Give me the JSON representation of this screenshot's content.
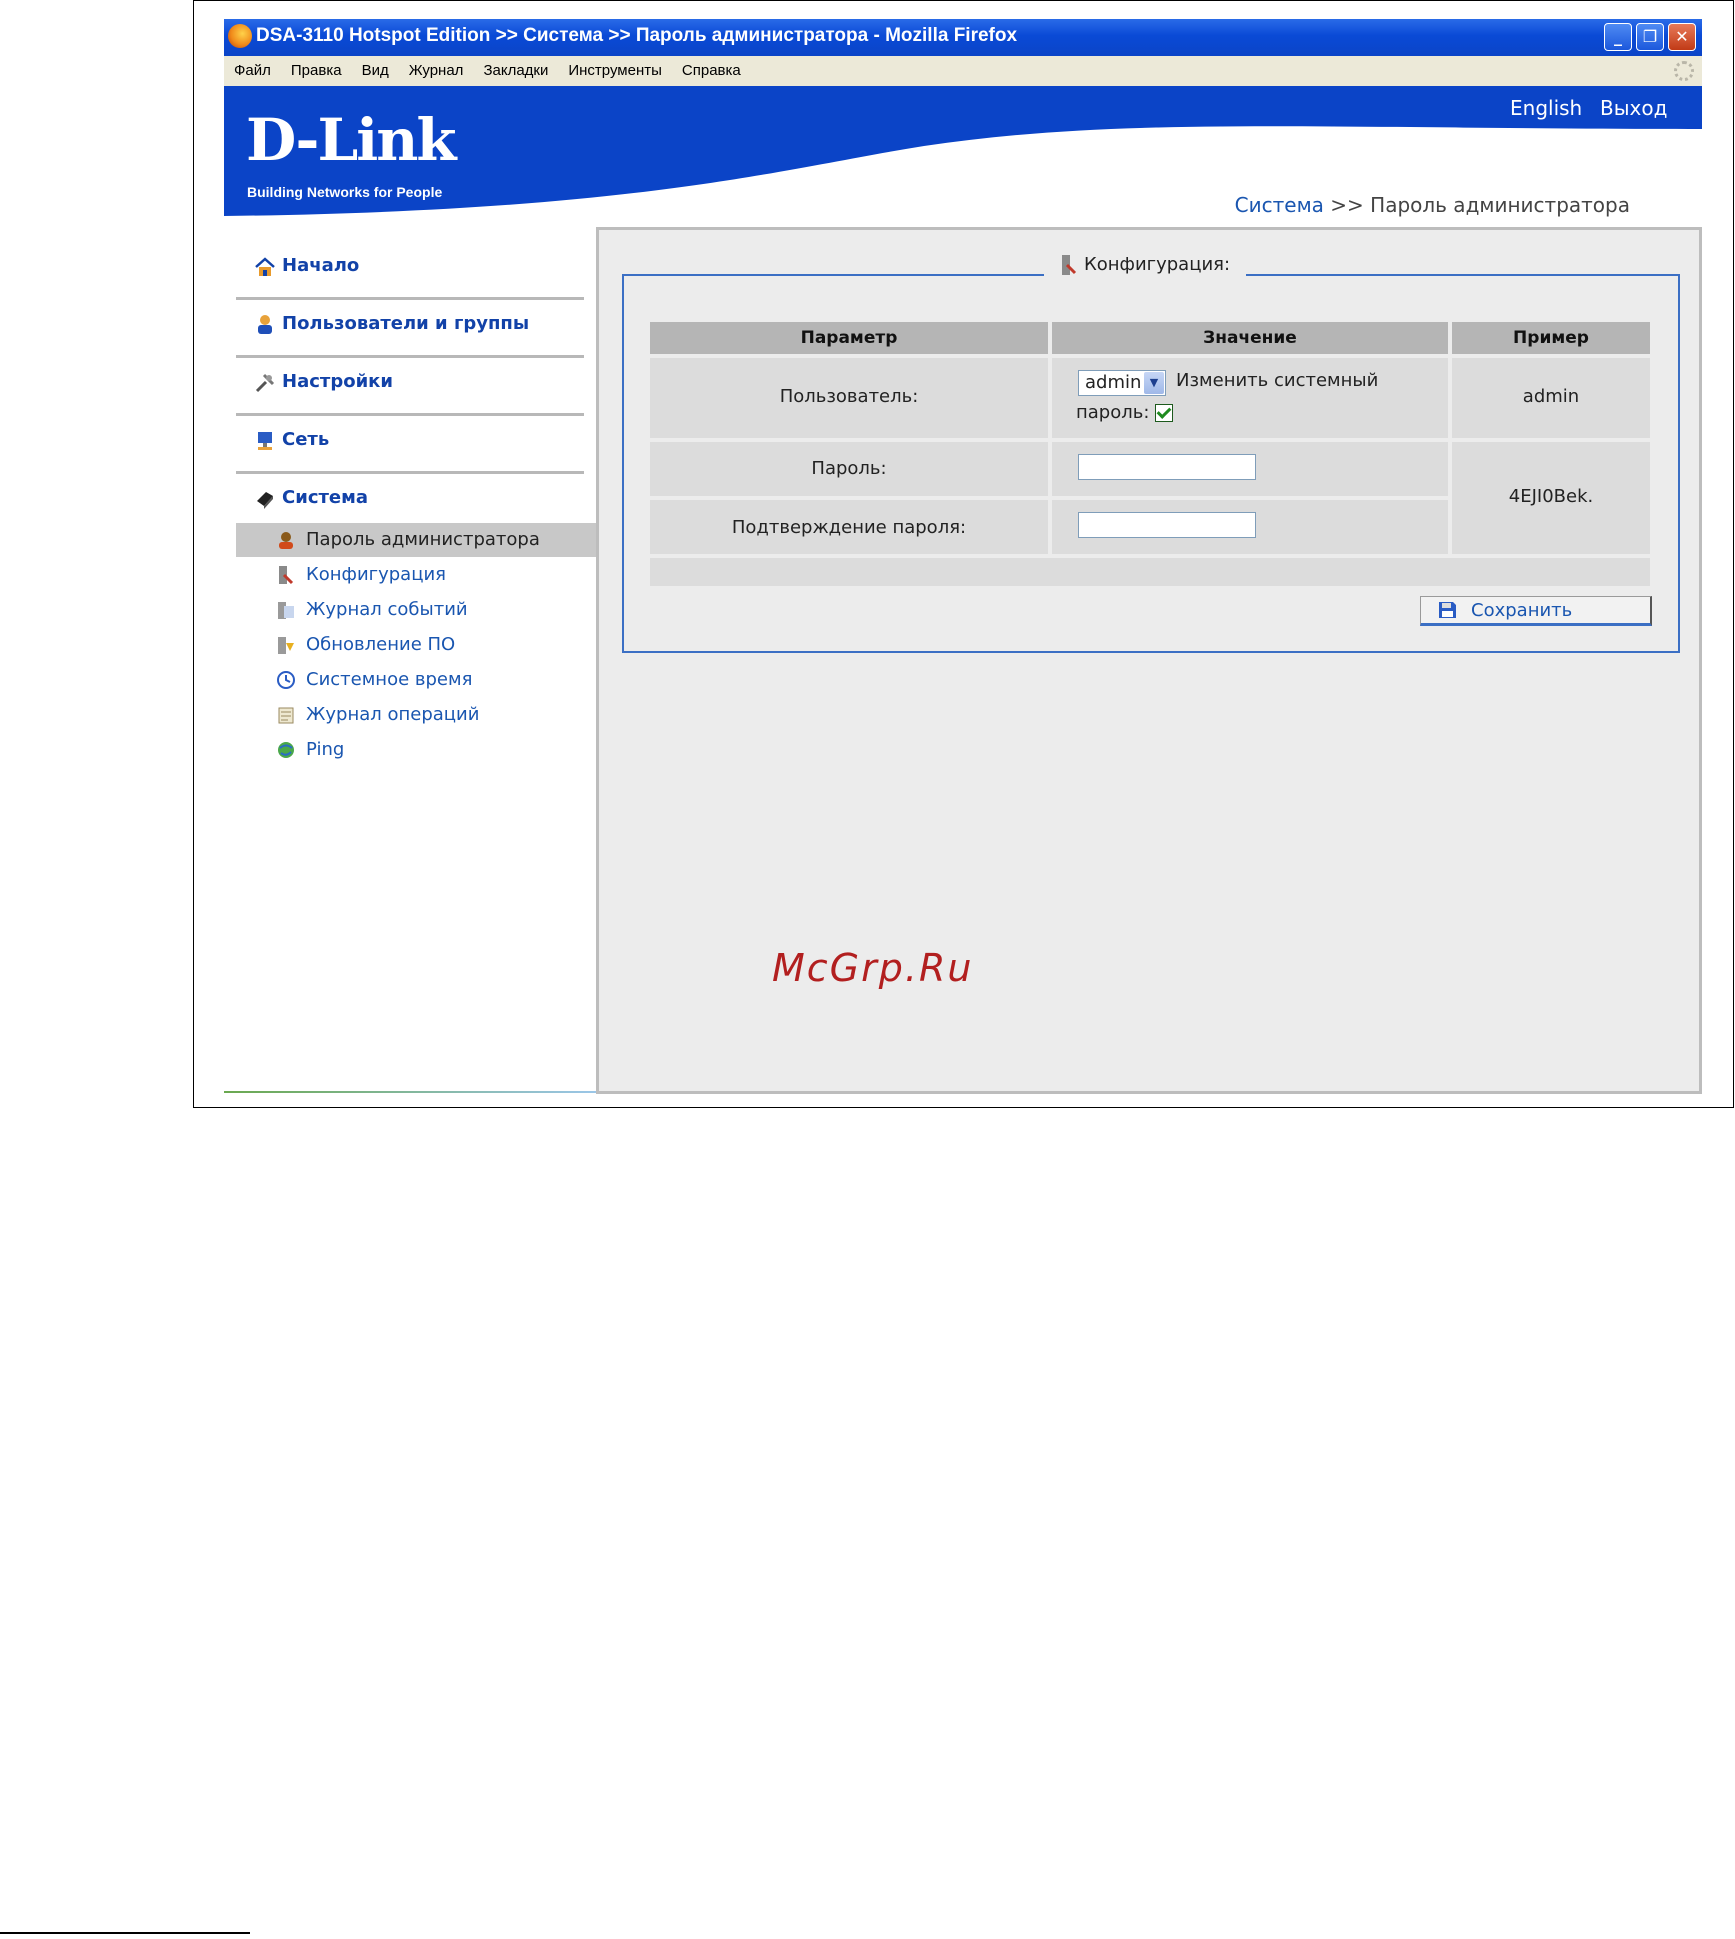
{
  "window": {
    "title": "DSA-3110 Hotspot Edition >> Система >> Пароль администратора - Mozilla Firefox",
    "buttons": [
      "minimize",
      "restore",
      "close"
    ]
  },
  "menu": [
    "Файл",
    "Правка",
    "Вид",
    "Журнал",
    "Закладки",
    "Инструменты",
    "Справка"
  ],
  "header": {
    "logo": "D-Link",
    "tagline": "Building Networks for People",
    "links": {
      "english": "English",
      "logout": "Выход"
    }
  },
  "breadcrumb": {
    "section": "Система",
    "separator": ">>",
    "current": "Пароль администратора"
  },
  "sidebar": {
    "sections": [
      {
        "label": "Начало",
        "icon": "home-icon"
      },
      {
        "label": "Пользователи и группы",
        "icon": "users-icon"
      },
      {
        "label": "Настройки",
        "icon": "tools-icon"
      },
      {
        "label": "Сеть",
        "icon": "network-icon"
      },
      {
        "label": "Система",
        "icon": "system-icon"
      }
    ],
    "items": [
      {
        "label": "Пароль администратора",
        "icon": "admin-icon",
        "active": true
      },
      {
        "label": "Конфигурация",
        "icon": "config-icon"
      },
      {
        "label": "Журнал событий",
        "icon": "event-log-icon"
      },
      {
        "label": "Обновление ПО",
        "icon": "firmware-icon"
      },
      {
        "label": "Системное время",
        "icon": "clock-icon"
      },
      {
        "label": "Журнал операций",
        "icon": "operations-log-icon"
      },
      {
        "label": "Ping",
        "icon": "ping-icon"
      }
    ]
  },
  "config": {
    "legend": "Конфигурация:",
    "headers": {
      "param": "Параметр",
      "value": "Значение",
      "example": "Пример"
    },
    "user": {
      "label": "Пользователь:",
      "selected": "admin",
      "change_text": "Изменить системный",
      "change_text2": "пароль:",
      "checked": true,
      "example": "admin"
    },
    "password": {
      "label": "Пароль:",
      "value": ""
    },
    "confirm": {
      "label": "Подтверждение пароля:",
      "value": ""
    },
    "password_example": "4EJI0Bek.",
    "save_label": "Сохранить"
  },
  "watermark": "McGrp.Ru",
  "colors": {
    "brand_blue": "#0b44c7",
    "link_blue": "#1a56b0",
    "fieldset_border": "#3b6fc4"
  }
}
